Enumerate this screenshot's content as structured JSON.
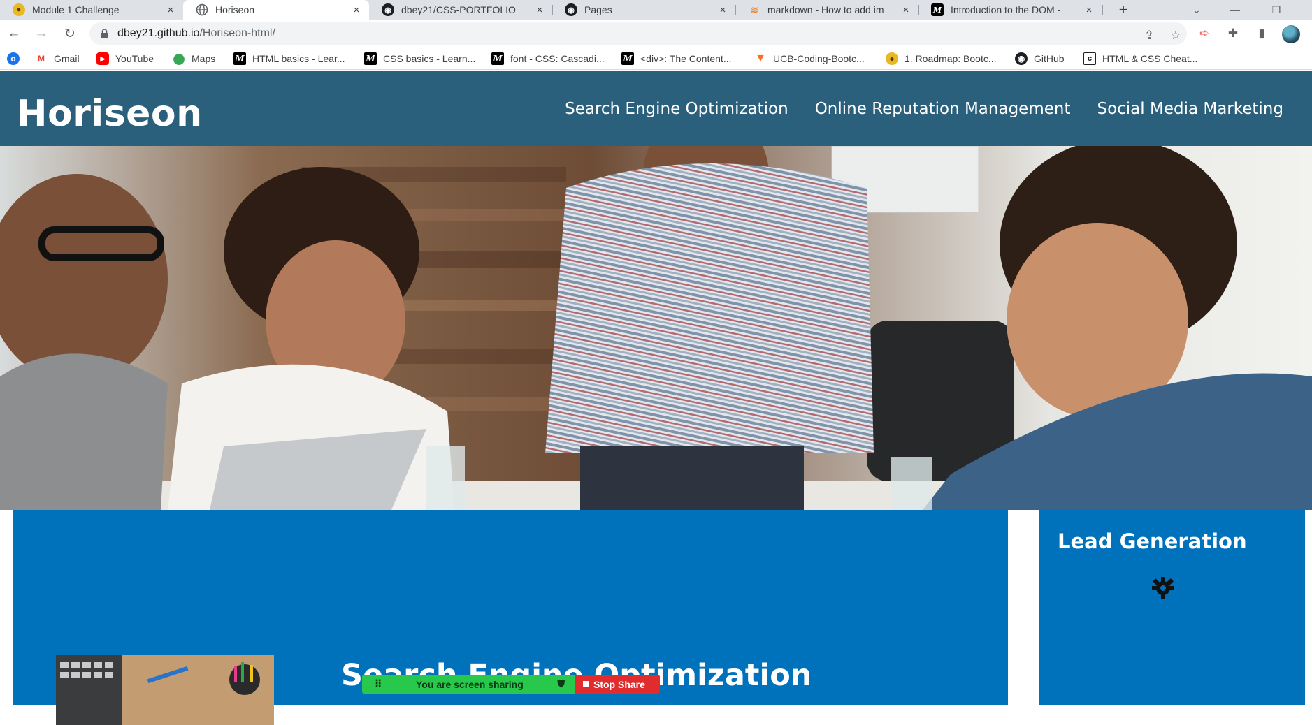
{
  "browser": {
    "tabs": [
      {
        "title": "Module 1 Challenge",
        "favicon": "bootcamp-coin-icon",
        "active": false
      },
      {
        "title": "Horiseon",
        "favicon": "globe-icon",
        "active": true
      },
      {
        "title": "dbey21/CSS-PORTFOLIO",
        "favicon": "github-icon",
        "active": false
      },
      {
        "title": "Pages",
        "favicon": "github-icon",
        "active": false
      },
      {
        "title": "markdown - How to add im",
        "favicon": "stackoverflow-icon",
        "active": false
      },
      {
        "title": "Introduction to the DOM -",
        "favicon": "mdn-icon",
        "active": false
      }
    ],
    "close_glyph": "×",
    "new_tab_glyph": "+",
    "address": {
      "host": "dbey21.github.io",
      "path": "/Horiseon-html/"
    },
    "bookmarks": [
      {
        "label": "Gmail",
        "icon": "gmail-icon"
      },
      {
        "label": "YouTube",
        "icon": "youtube-icon"
      },
      {
        "label": "Maps",
        "icon": "maps-icon"
      },
      {
        "label": "HTML basics - Lear...",
        "icon": "mdn-icon"
      },
      {
        "label": "CSS basics - Learn...",
        "icon": "mdn-icon"
      },
      {
        "label": "font - CSS: Cascadi...",
        "icon": "mdn-icon"
      },
      {
        "label": "<div>: The Content...",
        "icon": "mdn-icon"
      },
      {
        "label": "UCB-Coding-Bootc...",
        "icon": "gitlab-icon"
      },
      {
        "label": "1. Roadmap: Bootc...",
        "icon": "bootcamp-coin-icon"
      },
      {
        "label": "GitHub",
        "icon": "github-icon"
      },
      {
        "label": "HTML & CSS Cheat...",
        "icon": "cheatsheet-icon"
      }
    ]
  },
  "site": {
    "logo": "Horiseon",
    "nav": [
      "Search Engine Optimization",
      "Online Reputation Management",
      "Social Media Marketing"
    ],
    "main_section_title": "Search Engine Optimization",
    "aside_title": "Lead Generation"
  },
  "share_bar": {
    "message": "You are screen sharing",
    "stop_label": "Stop Share"
  },
  "colors": {
    "header_bg": "#2a607c",
    "content_bg": "#0072bb",
    "share_green": "#27c84b",
    "share_red": "#e02c2c"
  }
}
